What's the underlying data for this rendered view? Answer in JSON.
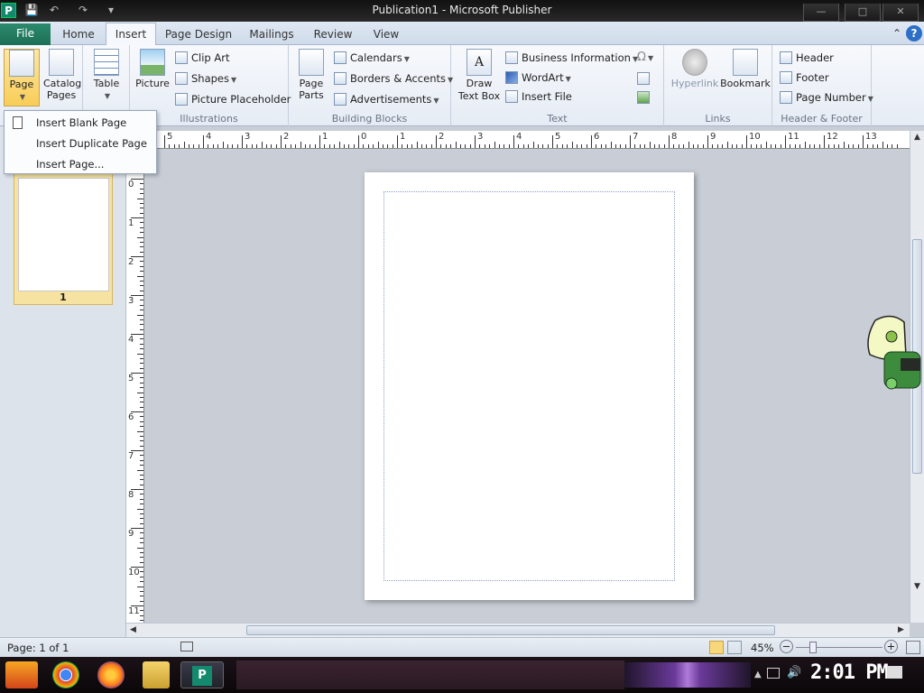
{
  "window": {
    "title": "Publication1 - Microsoft Publisher",
    "app_icon": "P",
    "controls": {
      "minimize": "—",
      "maximize": "□",
      "close": "✕"
    }
  },
  "qat": {
    "save": "💾",
    "undo": "↶",
    "redo": "↷",
    "customize": "▾"
  },
  "tabs": [
    {
      "label": "File"
    },
    {
      "label": "Home"
    },
    {
      "label": "Insert"
    },
    {
      "label": "Page Design"
    },
    {
      "label": "Mailings"
    },
    {
      "label": "Review"
    },
    {
      "label": "View"
    }
  ],
  "ribbon": {
    "pages": {
      "page": "Page",
      "catalog": "Catalog Pages"
    },
    "tables": {
      "table": "Table"
    },
    "illustrations": {
      "picture": "Picture",
      "clip_art": "Clip Art",
      "shapes": "Shapes",
      "picture_placeholder": "Picture Placeholder",
      "label": "Illustrations"
    },
    "building_blocks": {
      "page_parts": "Page Parts",
      "calendars": "Calendars",
      "borders": "Borders & Accents",
      "ads": "Advertisements",
      "label": "Building Blocks"
    },
    "text": {
      "draw_text_box": "Draw Text Box",
      "business_info": "Business Information",
      "wordart": "WordArt",
      "insert_file": "Insert File",
      "label": "Text"
    },
    "links": {
      "hyperlink": "Hyperlink",
      "bookmark": "Bookmark",
      "label": "Links"
    },
    "header_footer": {
      "header": "Header",
      "footer": "Footer",
      "page_number": "Page Number",
      "label": "Header & Footer"
    }
  },
  "page_menu": {
    "items": [
      "Insert Blank Page",
      "Insert Duplicate Page",
      "Insert Page..."
    ]
  },
  "thumbnail": {
    "number": "1"
  },
  "ruler": {
    "h": [
      "5",
      "4",
      "3",
      "2",
      "1",
      "0",
      "1",
      "2",
      "3",
      "4",
      "5",
      "6",
      "7",
      "8",
      "9",
      "10",
      "11",
      "12",
      "13"
    ],
    "v": [
      "0",
      "1",
      "2",
      "3",
      "4",
      "5",
      "6",
      "7",
      "8",
      "9",
      "10",
      "11"
    ]
  },
  "status": {
    "page": "Page: 1 of 1",
    "zoom": "45%"
  },
  "taskbar": {
    "clock": "2:01 PM"
  }
}
